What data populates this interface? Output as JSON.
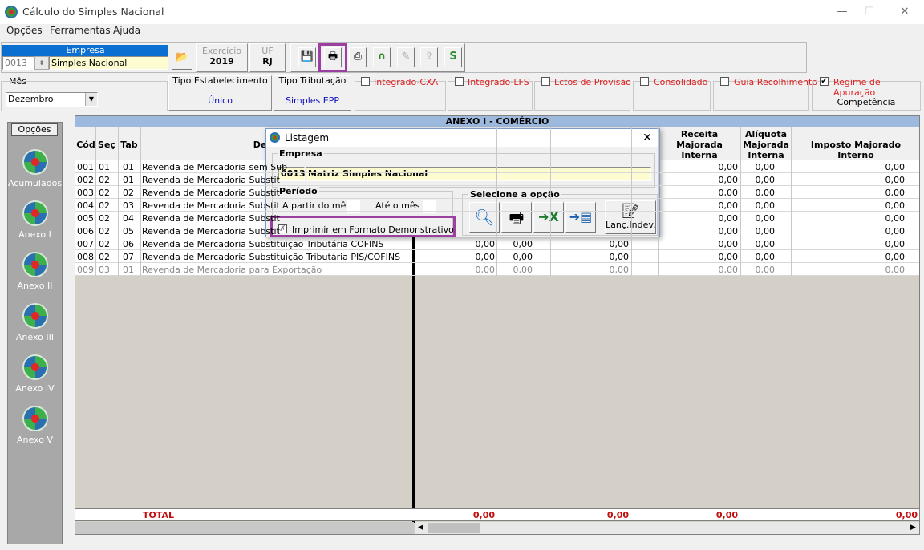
{
  "window": {
    "title": "Cálculo do Simples Nacional",
    "minimize": "—",
    "maximize": "☐",
    "close": "✕"
  },
  "menu": [
    "Opções",
    "Ferramentas",
    "Ajuda"
  ],
  "empresa": {
    "label": "Empresa",
    "code": "0013",
    "name": "Simples Nacional"
  },
  "exercicio": {
    "label": "Exercício",
    "value": "2019"
  },
  "uf": {
    "label": "UF",
    "value": "RJ"
  },
  "mes": {
    "label": "Mês",
    "value": "Dezembro"
  },
  "tipo_estab": {
    "label": "Tipo Estabelecimento",
    "value": "Único"
  },
  "tipo_trib": {
    "label": "Tipo Tributação",
    "value": "Simples EPP"
  },
  "checks": [
    {
      "label": "Integrado-CXA",
      "checked": false
    },
    {
      "label": "Integrado-LFS",
      "checked": false
    },
    {
      "label": "Lctos de Provisão",
      "checked": false
    },
    {
      "label": "Consolidado",
      "checked": false
    },
    {
      "label": "Guia Recolhimento",
      "checked": false
    }
  ],
  "regime": {
    "label": "Regime de Apuração",
    "value": "Competência",
    "checked": true
  },
  "sidebar": {
    "header": "Opções",
    "items": [
      "Acumulados",
      "Anexo I",
      "Anexo II",
      "Anexo III",
      "Anexo IV",
      "Anexo V"
    ]
  },
  "grid": {
    "banner": "ANEXO I - COMÉRCIO",
    "headers": {
      "cod": "Cód",
      "sec": "Seç",
      "tab": "Tab",
      "desc": "De",
      "receita": "Receita Majorada Interna",
      "aliquota": "Alíquota Majorada Interna",
      "imposto": "Imposto Majorado Interno"
    },
    "rows": [
      {
        "cod": "001",
        "sec": "01",
        "tab": "01",
        "desc": "Revenda de Mercadoria sem Sub",
        "c1": "",
        "c2": "",
        "c3": "",
        "rec": "0,00",
        "ali": "0,00",
        "imp": "0,00",
        "dim": false
      },
      {
        "cod": "002",
        "sec": "02",
        "tab": "01",
        "desc": "Revenda de Mercadoria  Substit",
        "c1": "",
        "c2": "",
        "c3": "",
        "rec": "0,00",
        "ali": "0,00",
        "imp": "0,00",
        "dim": false
      },
      {
        "cod": "003",
        "sec": "02",
        "tab": "02",
        "desc": "Revenda de Mercadoria  Substit",
        "c1": "",
        "c2": "",
        "c3": "",
        "rec": "0,00",
        "ali": "0,00",
        "imp": "0,00",
        "dim": false
      },
      {
        "cod": "004",
        "sec": "02",
        "tab": "03",
        "desc": "Revenda de Mercadoria  Substit",
        "c1": "",
        "c2": "",
        "c3": "",
        "rec": "0,00",
        "ali": "0,00",
        "imp": "0,00",
        "dim": false
      },
      {
        "cod": "005",
        "sec": "02",
        "tab": "04",
        "desc": "Revenda de Mercadoria  Substit",
        "c1": "",
        "c2": "",
        "c3": "",
        "rec": "0,00",
        "ali": "0,00",
        "imp": "0,00",
        "dim": false
      },
      {
        "cod": "006",
        "sec": "02",
        "tab": "05",
        "desc": "Revenda de Mercadoria  Substit",
        "c1": "",
        "c2": "",
        "c3": "",
        "rec": "0,00",
        "ali": "0,00",
        "imp": "0,00",
        "dim": false
      },
      {
        "cod": "007",
        "sec": "02",
        "tab": "06",
        "desc": "Revenda de Mercadoria  Substituição Tributária COFINS",
        "c1": "0,00",
        "c2": "0,00",
        "c3": "0,00",
        "rec": "0,00",
        "ali": "0,00",
        "imp": "0,00",
        "dim": false
      },
      {
        "cod": "008",
        "sec": "02",
        "tab": "07",
        "desc": "Revenda de Mercadoria  Substituição Tributária PIS/COFINS",
        "c1": "0,00",
        "c2": "0,00",
        "c3": "0,00",
        "rec": "0,00",
        "ali": "0,00",
        "imp": "0,00",
        "dim": false
      },
      {
        "cod": "009",
        "sec": "03",
        "tab": "01",
        "desc": "Revenda de Mercadoria para Exportação",
        "c1": "0,00",
        "c2": "0,00",
        "c3": "0,00",
        "rec": "0,00",
        "ali": "0,00",
        "imp": "0,00",
        "dim": true
      }
    ],
    "total": {
      "label": "TOTAL",
      "t1": "0,00",
      "t2": "0,00",
      "t3": "0,00",
      "t4": "0,00"
    }
  },
  "dialog": {
    "title": "Listagem",
    "close": "✕",
    "empresa_label": "Empresa",
    "empresa_code": "0013",
    "empresa_name": "Matriz Simples Nacional",
    "periodo_label": "Período",
    "a_partir": "A partir do mês",
    "ate": "Até o mês",
    "imprimir": "Imprimir em Formato Demonstrativo",
    "selecione": "Selecione a opção",
    "lanc": "Lanç.Indev."
  },
  "colors": {
    "highlight": "#9b3fa0",
    "banner": "#9db9dd",
    "red": "#e02020",
    "blue": "#1010c0",
    "accent": "#0a6fd0"
  }
}
